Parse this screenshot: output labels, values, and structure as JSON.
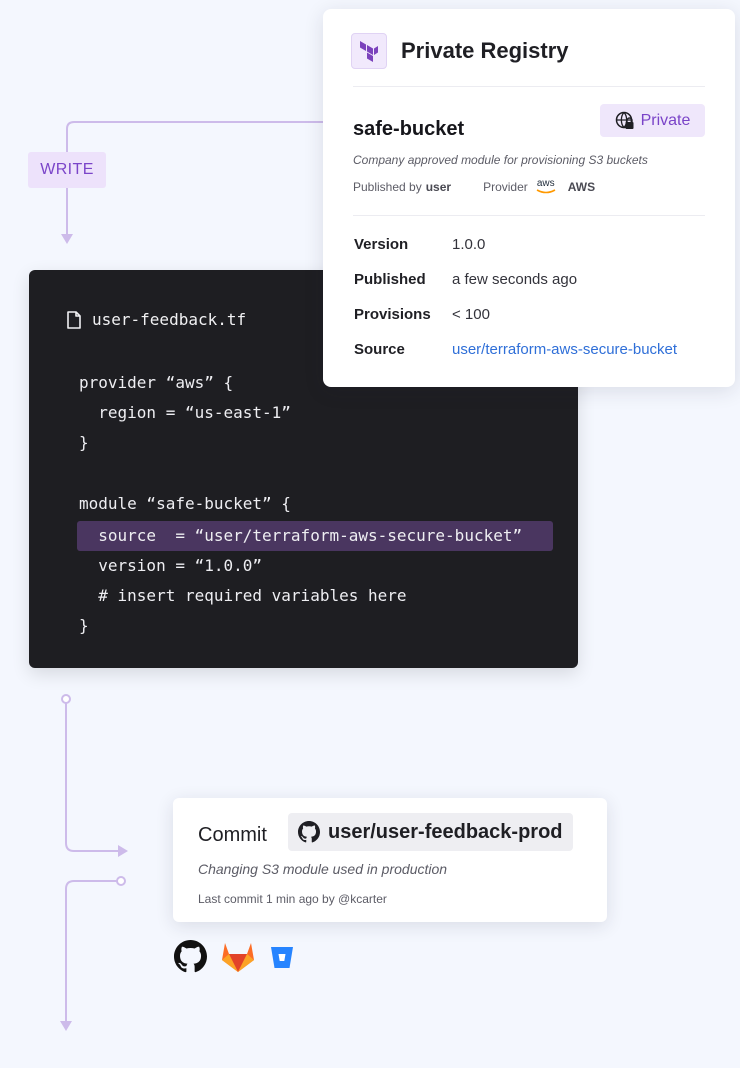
{
  "badge": {
    "write": "WRITE"
  },
  "code": {
    "filename": "user-feedback.tf",
    "lines": [
      "provider “aws” {",
      "  region = “us-east-1”",
      "}",
      "",
      "module “safe-bucket” {",
      "  source  = “user/terraform-aws-secure-bucket”",
      "  version = “1.0.0”",
      "  # insert required variables here",
      "}"
    ],
    "highlighted_line_index": 5
  },
  "registry": {
    "title": "Private Registry",
    "module_name": "safe-bucket",
    "visibility": "Private",
    "description": "Company approved module for provisioning S3 buckets",
    "published_by_label": "Published by",
    "published_by": "user",
    "provider_label": "Provider",
    "provider_logo_text": "aws",
    "provider": "AWS",
    "properties": [
      {
        "key": "Version",
        "value": "1.0.0"
      },
      {
        "key": "Published",
        "value": "a few seconds ago"
      },
      {
        "key": "Provisions",
        "value": "< 100"
      },
      {
        "key": "Source",
        "value": "user/terraform-aws-secure-bucket"
      }
    ]
  },
  "commit": {
    "label": "Commit",
    "repo": "user/user-feedback-prod",
    "message": "Changing S3 module used in production",
    "meta": "Last commit 1 min ago by @kcarter"
  },
  "vcs_icons": [
    "github-icon",
    "gitlab-icon",
    "bitbucket-icon"
  ],
  "colors": {
    "accent_purple": "#7b45c9",
    "connector": "#c9b6ea",
    "code_bg": "#1e1e22",
    "highlight": "#4a3660",
    "link": "#2f6fd8"
  }
}
